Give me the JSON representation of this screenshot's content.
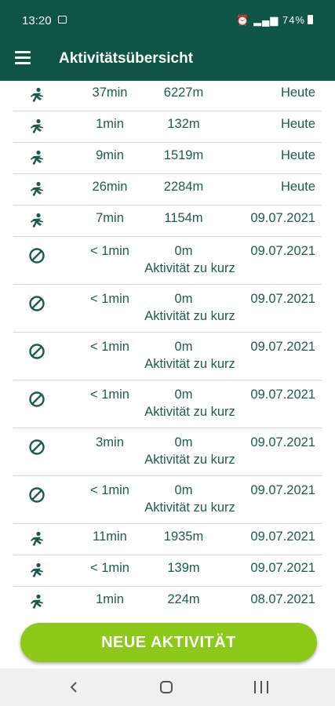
{
  "status": {
    "time": "13:20",
    "battery": "74%"
  },
  "app": {
    "title": "Aktivitätsübersicht"
  },
  "rows": [
    {
      "icon": "running-icon",
      "duration": "37min",
      "distance": "6227m",
      "date": "Heute",
      "note": ""
    },
    {
      "icon": "running-icon",
      "duration": "1min",
      "distance": "132m",
      "date": "Heute",
      "note": ""
    },
    {
      "icon": "running-icon",
      "duration": "9min",
      "distance": "1519m",
      "date": "Heute",
      "note": ""
    },
    {
      "icon": "running-icon",
      "duration": "26min",
      "distance": "2284m",
      "date": "Heute",
      "note": ""
    },
    {
      "icon": "running-icon",
      "duration": "7min",
      "distance": "1154m",
      "date": "09.07.2021",
      "note": ""
    },
    {
      "icon": "prohibited-icon",
      "duration": "< 1min",
      "distance": "0m",
      "date": "09.07.2021",
      "note": "Aktivität zu kurz"
    },
    {
      "icon": "prohibited-icon",
      "duration": "< 1min",
      "distance": "0m",
      "date": "09.07.2021",
      "note": "Aktivität zu kurz"
    },
    {
      "icon": "prohibited-icon",
      "duration": "< 1min",
      "distance": "0m",
      "date": "09.07.2021",
      "note": "Aktivität zu kurz"
    },
    {
      "icon": "prohibited-icon",
      "duration": "< 1min",
      "distance": "0m",
      "date": "09.07.2021",
      "note": "Aktivität zu kurz"
    },
    {
      "icon": "prohibited-icon",
      "duration": "3min",
      "distance": "0m",
      "date": "09.07.2021",
      "note": "Aktivität zu kurz"
    },
    {
      "icon": "prohibited-icon",
      "duration": "< 1min",
      "distance": "0m",
      "date": "09.07.2021",
      "note": "Aktivität zu kurz"
    },
    {
      "icon": "running-icon",
      "duration": "11min",
      "distance": "1935m",
      "date": "09.07.2021",
      "note": ""
    },
    {
      "icon": "running-icon",
      "duration": "< 1min",
      "distance": "139m",
      "date": "09.07.2021",
      "note": ""
    },
    {
      "icon": "running-icon",
      "duration": "1min",
      "distance": "224m",
      "date": "08.07.2021",
      "note": ""
    }
  ],
  "fab": {
    "label": "NEUE AKTIVITÄT"
  },
  "colors": {
    "header": "#0e5447",
    "text": "#1d5b4e",
    "accent": "#8cc919"
  }
}
